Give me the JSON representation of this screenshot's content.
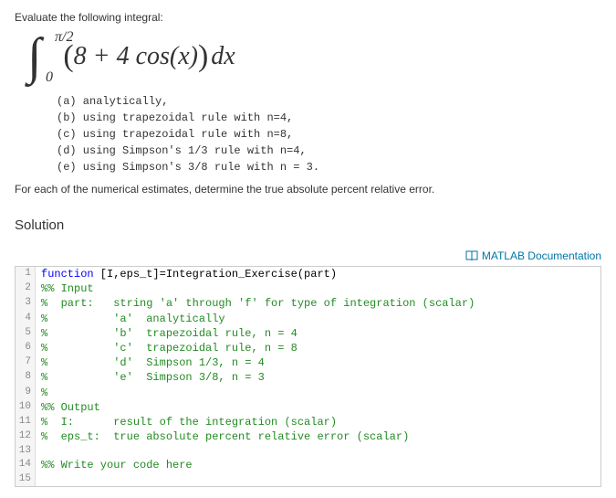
{
  "prompt": "Evaluate the following integral:",
  "integral": {
    "symbol": "∫",
    "upper": "π/2",
    "lower": "0",
    "lparen": "(",
    "expr": "8 + 4 cos(x)",
    "rparen": ")",
    "dx": "dx"
  },
  "options": "(a) analytically,\n(b) using trapezoidal rule with n=4,\n(c) using trapezoidal rule with n=8,\n(d) using Simpson's 1/3 rule with n=4,\n(e) using Simpson's 3/8 rule with n = 3.",
  "followup": "For each of the numerical estimates, determine the true absolute percent relative error.",
  "solution_heading": "Solution",
  "doclink": "MATLAB Documentation",
  "code_lines": [
    {
      "n": 1,
      "segs": [
        {
          "c": "kw",
          "t": "function"
        },
        {
          "c": "",
          "t": " [I,eps_t]=Integration_Exercise(part)"
        }
      ]
    },
    {
      "n": 2,
      "segs": [
        {
          "c": "cm",
          "t": "%% Input"
        }
      ]
    },
    {
      "n": 3,
      "segs": [
        {
          "c": "cm",
          "t": "%  part:   string 'a' through 'f' for type of integration (scalar)"
        }
      ]
    },
    {
      "n": 4,
      "segs": [
        {
          "c": "cm",
          "t": "%          'a'  analytically"
        }
      ]
    },
    {
      "n": 5,
      "segs": [
        {
          "c": "cm",
          "t": "%          'b'  trapezoidal rule, n = 4"
        }
      ]
    },
    {
      "n": 6,
      "segs": [
        {
          "c": "cm",
          "t": "%          'c'  trapezoidal rule, n = 8"
        }
      ]
    },
    {
      "n": 7,
      "segs": [
        {
          "c": "cm",
          "t": "%          'd'  Simpson 1/3, n = 4"
        }
      ]
    },
    {
      "n": 8,
      "segs": [
        {
          "c": "cm",
          "t": "%          'e'  Simpson 3/8, n = 3"
        }
      ]
    },
    {
      "n": 9,
      "segs": [
        {
          "c": "cm",
          "t": "%"
        }
      ]
    },
    {
      "n": 10,
      "segs": [
        {
          "c": "cm",
          "t": "%% Output"
        }
      ]
    },
    {
      "n": 11,
      "segs": [
        {
          "c": "cm",
          "t": "%  I:      result of the integration (scalar)"
        }
      ]
    },
    {
      "n": 12,
      "segs": [
        {
          "c": "cm",
          "t": "%  eps_t:  true absolute percent relative error (scalar)"
        }
      ]
    },
    {
      "n": 13,
      "segs": [
        {
          "c": "",
          "t": ""
        }
      ]
    },
    {
      "n": 14,
      "segs": [
        {
          "c": "cm",
          "t": "%% Write your code here"
        }
      ]
    },
    {
      "n": 15,
      "segs": [
        {
          "c": "",
          "t": ""
        }
      ]
    }
  ]
}
